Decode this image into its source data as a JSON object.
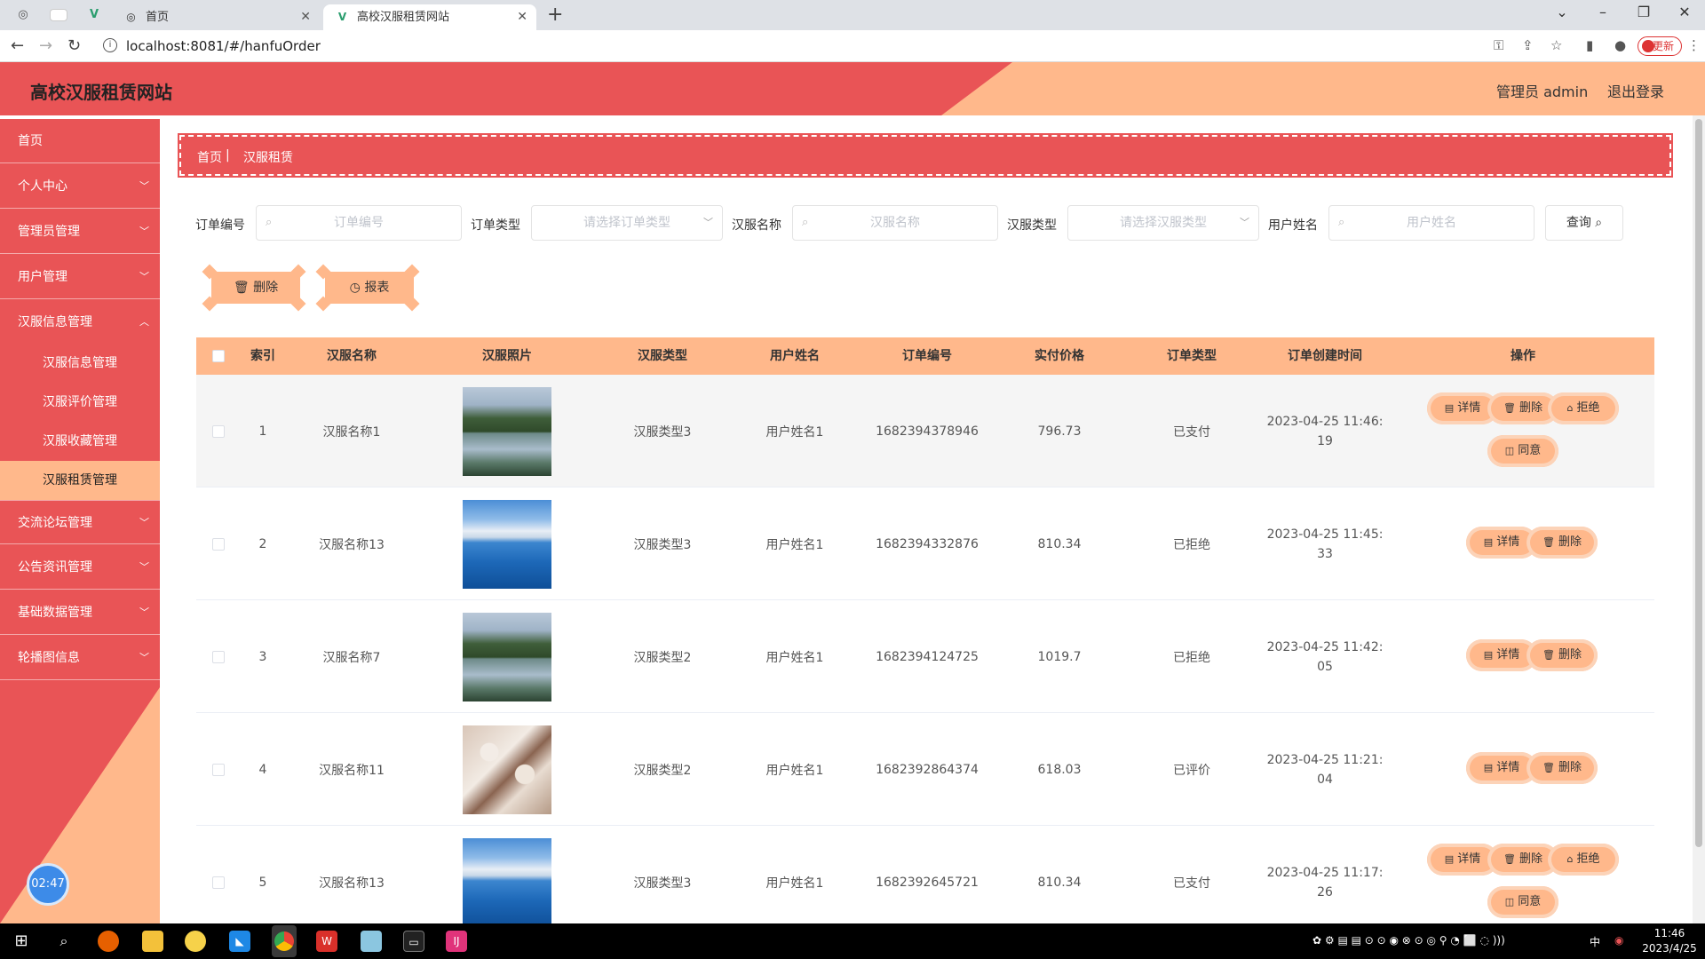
{
  "browser": {
    "tabs": [
      {
        "title": "首页"
      },
      {
        "title": "高校汉服租赁网站"
      }
    ],
    "url": "localhost:8081/#/hanfuOrder",
    "update_label": "更新"
  },
  "header": {
    "title": "高校汉服租赁网站",
    "user": "管理员 admin",
    "logout": "退出登录"
  },
  "sidebar": {
    "items": [
      {
        "label": "首页"
      },
      {
        "label": "个人中心"
      },
      {
        "label": "管理员管理"
      },
      {
        "label": "用户管理"
      },
      {
        "label": "汉服信息管理"
      },
      {
        "label": "交流论坛管理"
      },
      {
        "label": "公告资讯管理"
      },
      {
        "label": "基础数据管理"
      },
      {
        "label": "轮播图信息"
      }
    ],
    "subitems": [
      {
        "label": "汉服信息管理"
      },
      {
        "label": "汉服评价管理"
      },
      {
        "label": "汉服收藏管理"
      },
      {
        "label": "汉服租赁管理"
      }
    ],
    "clock": "02:47"
  },
  "breadcrumb": {
    "home": "首页",
    "current": "汉服租赁"
  },
  "search": {
    "order_no_label": "订单编号",
    "order_no_placeholder": "订单编号",
    "order_type_label": "订单类型",
    "order_type_placeholder": "请选择订单类型",
    "hanfu_name_label": "汉服名称",
    "hanfu_name_placeholder": "汉服名称",
    "hanfu_type_label": "汉服类型",
    "hanfu_type_placeholder": "请选择汉服类型",
    "user_name_label": "用户姓名",
    "user_name_placeholder": "用户姓名",
    "query_label": "查询"
  },
  "actions": {
    "delete_label": "删除",
    "report_label": "报表"
  },
  "table": {
    "columns": [
      "索引",
      "汉服名称",
      "汉服照片",
      "汉服类型",
      "用户姓名",
      "订单编号",
      "实付价格",
      "订单类型",
      "订单创建时间",
      "操作"
    ],
    "rows": [
      {
        "index": "1",
        "name": "汉服名称1",
        "type": "汉服类型3",
        "user": "用户姓名1",
        "order_no": "1682394378946",
        "price": "796.73",
        "order_type": "已支付",
        "time1": "2023-04-25 11:46:",
        "time2": "19",
        "photo": "mountain"
      },
      {
        "index": "2",
        "name": "汉服名称13",
        "type": "汉服类型3",
        "user": "用户姓名1",
        "order_no": "1682394332876",
        "price": "810.34",
        "order_type": "已拒绝",
        "time1": "2023-04-25 11:45:",
        "time2": "33",
        "photo": "sea"
      },
      {
        "index": "3",
        "name": "汉服名称7",
        "type": "汉服类型2",
        "user": "用户姓名1",
        "order_no": "1682394124725",
        "price": "1019.7",
        "order_type": "已拒绝",
        "time1": "2023-04-25 11:42:",
        "time2": "05",
        "photo": "mountain"
      },
      {
        "index": "4",
        "name": "汉服名称11",
        "type": "汉服类型2",
        "user": "用户姓名1",
        "order_no": "1682392864374",
        "price": "618.03",
        "order_type": "已评价",
        "time1": "2023-04-25 11:21:",
        "time2": "04",
        "photo": "blossom"
      },
      {
        "index": "5",
        "name": "汉服名称13",
        "type": "汉服类型3",
        "user": "用户姓名1",
        "order_no": "1682392645721",
        "price": "810.34",
        "order_type": "已支付",
        "time1": "2023-04-25 11:17:",
        "time2": "26",
        "photo": "sea"
      }
    ],
    "op_labels": {
      "detail": "详情",
      "delete": "删除",
      "reject": "拒绝",
      "agree": "同意"
    }
  },
  "taskbar": {
    "time": "11:46",
    "date": "2023/4/25",
    "ime": "中"
  },
  "colors": {
    "primary": "#e95456",
    "accent": "#ffb88b"
  }
}
